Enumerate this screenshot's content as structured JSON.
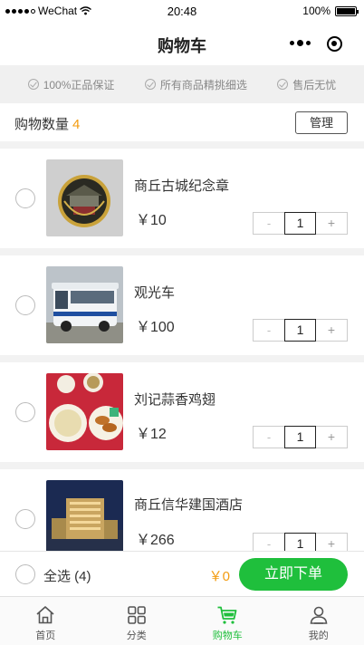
{
  "status_bar": {
    "carrier": "WeChat",
    "time": "20:48",
    "battery": "100%"
  },
  "nav": {
    "title": "购物车"
  },
  "promises": [
    "100%正品保证",
    "所有商品精挑细选",
    "售后无忧"
  ],
  "count_bar": {
    "label": "购物数量",
    "count": "4",
    "manage_label": "管理"
  },
  "items": [
    {
      "name": "商丘古城纪念章",
      "price": "￥10",
      "qty": "1",
      "minus": "-",
      "plus": "+"
    },
    {
      "name": "观光车",
      "price": "￥100",
      "qty": "1",
      "minus": "-",
      "plus": "+"
    },
    {
      "name": "刘记蒜香鸡翅",
      "price": "￥12",
      "qty": "1",
      "minus": "-",
      "plus": "+"
    },
    {
      "name": "商丘信华建国酒店",
      "price": "￥266",
      "qty": "1",
      "minus": "-",
      "plus": "+"
    }
  ],
  "checkout": {
    "select_all": "全选 (4)",
    "total": "￥0",
    "buy_label": "立即下单"
  },
  "tabs": [
    {
      "label": "首页",
      "icon": "home-icon"
    },
    {
      "label": "分类",
      "icon": "grid-icon"
    },
    {
      "label": "购物车",
      "icon": "cart-icon",
      "active": true
    },
    {
      "label": "我的",
      "icon": "user-icon"
    }
  ],
  "colors": {
    "accent_green": "#1fbf3c",
    "price_orange": "#f39c12"
  }
}
